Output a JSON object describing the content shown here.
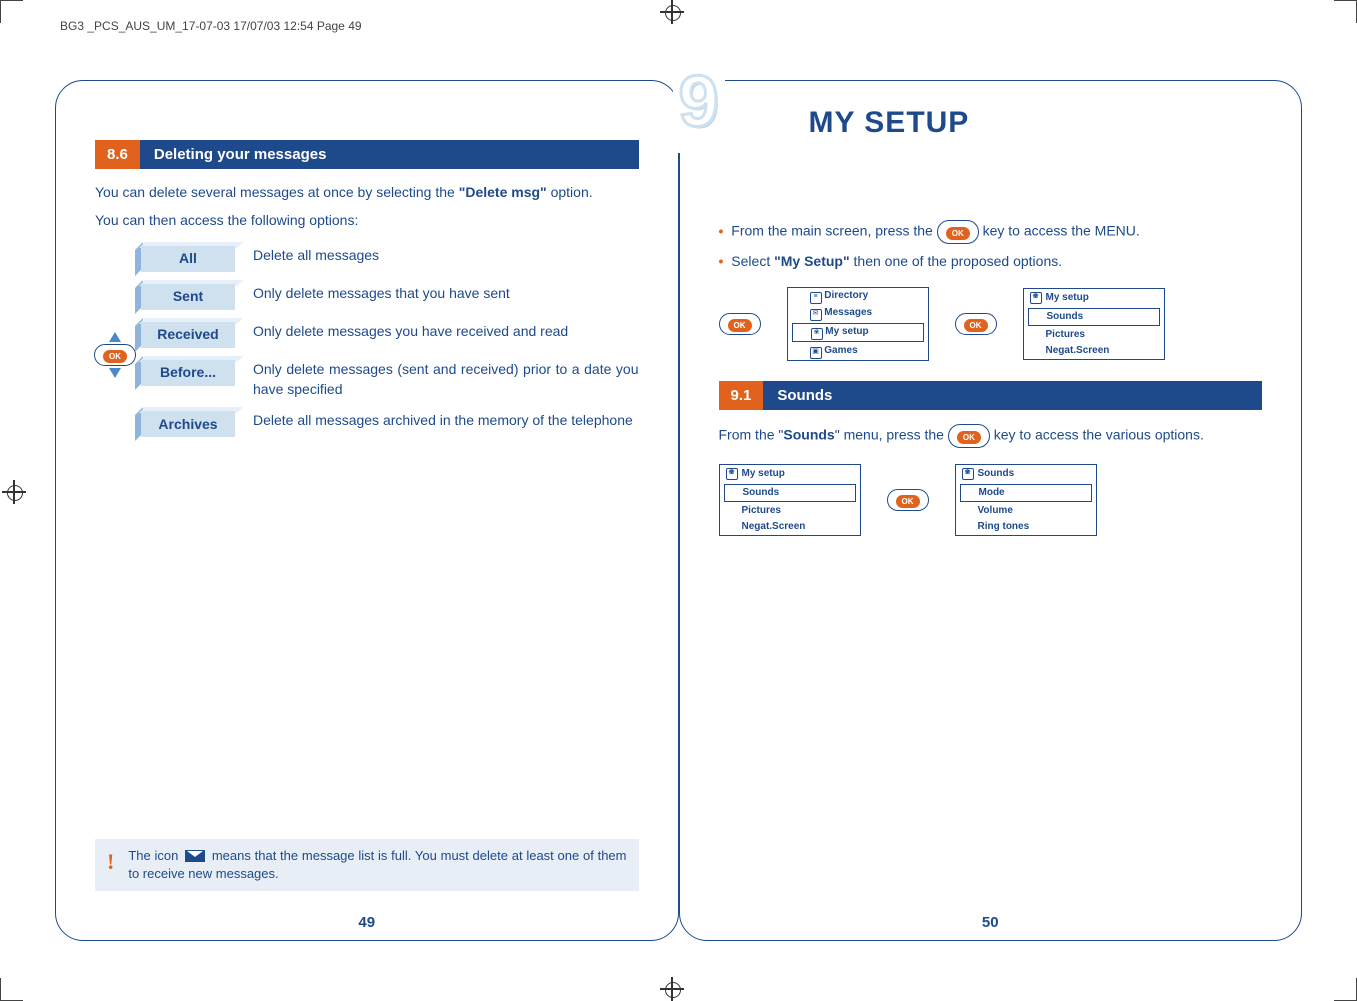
{
  "meta": {
    "header": "BG3 _PCS_AUS_UM_17-07-03  17/07/03  12:54  Page 49"
  },
  "left_page": {
    "section_num": "8.6",
    "section_title": "Deleting your messages",
    "intro1_a": "You can delete several messages at once by selecting the ",
    "intro1_b": "\"Delete msg\"",
    "intro1_c": " option.",
    "intro2": "You can then access the following options:",
    "defs": [
      {
        "label": "All",
        "text": "Delete all messages"
      },
      {
        "label": "Sent",
        "text": "Only delete messages that you have sent"
      },
      {
        "label": "Received",
        "text": "Only delete messages you have received and read"
      },
      {
        "label": "Before...",
        "text": "Only delete messages (sent and received) prior to a date you have specified"
      },
      {
        "label": "Archives",
        "text": "Delete all messages archived in the memory of  the telephone"
      }
    ],
    "note_a": "The icon ",
    "note_b": " means that the message list is full. You must delete at least one of them to receive new messages.",
    "page_num": "49",
    "ok_label": "OK"
  },
  "right_page": {
    "chapter_digit": "9",
    "chapter_title": "MY SETUP",
    "bullet1_a": "From the main screen, press the ",
    "bullet1_b": " key to access the MENU.",
    "bullet2_a": "Select ",
    "bullet2_b": "\"My Setup\"",
    "bullet2_c": " then one of the proposed options.",
    "menu1": {
      "items": [
        "Directory",
        "Messages",
        "My setup",
        "Games"
      ],
      "selected": 2
    },
    "menu2": {
      "title": "My setup",
      "items": [
        "Sounds",
        "Pictures",
        "Negat.Screen"
      ],
      "selected": 0
    },
    "section_num": "9.1",
    "section_title": "Sounds",
    "para_a": "From the \"",
    "para_b": "Sounds",
    "para_c": "\" menu, press the ",
    "para_d": " key to access the various options.",
    "menu3": {
      "title": "My setup",
      "items": [
        "Sounds",
        "Pictures",
        "Negat.Screen"
      ],
      "selected": 0
    },
    "menu4": {
      "title": "Sounds",
      "items": [
        "Mode",
        "Volume",
        "Ring tones"
      ],
      "selected": 0
    },
    "page_num": "50",
    "ok_label": "OK"
  }
}
